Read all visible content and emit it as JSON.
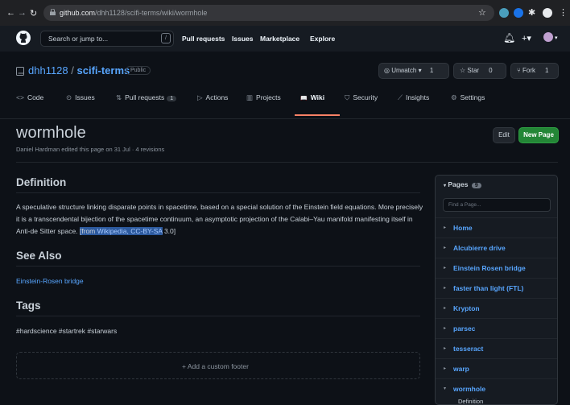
{
  "browser": {
    "url_host": "github.com",
    "url_path": "/dhh1128/scifi-terms/wiki/wormhole"
  },
  "header": {
    "search_placeholder": "Search or jump to...",
    "slash_key": "/",
    "nav": [
      "Pull requests",
      "Issues",
      "Marketplace",
      "Explore"
    ]
  },
  "repo": {
    "owner": "dhh1128",
    "separator": " / ",
    "name": "scifi-terms",
    "visibility": "Public",
    "unwatch_label": "Unwatch",
    "unwatch_count": "1",
    "star_label": "Star",
    "star_count": "0",
    "fork_label": "Fork",
    "fork_count": "1",
    "tabs": [
      {
        "label": "Code",
        "icon": "<>"
      },
      {
        "label": "Issues",
        "icon": "⊙"
      },
      {
        "label": "Pull requests",
        "icon": "⇅",
        "count": "1"
      },
      {
        "label": "Actions",
        "icon": "▷"
      },
      {
        "label": "Projects",
        "icon": "▥"
      },
      {
        "label": "Wiki",
        "icon": "📖"
      },
      {
        "label": "Security",
        "icon": "⛉"
      },
      {
        "label": "Insights",
        "icon": "⟋"
      },
      {
        "label": "Settings",
        "icon": "⚙"
      }
    ]
  },
  "page": {
    "title": "wormhole",
    "meta": "Daniel Hardman edited this page on 31 Jul · 4 revisions",
    "edit_label": "Edit",
    "new_page_label": "New Page",
    "definition_heading": "Definition",
    "definition_text": "A speculative structure linking disparate points in spacetime, based on a special solution of the Einstein field equations. More precisely it is a transcendental bijection of the spacetime continuum, an asymptotic projection of the Calabi–Yau manifold manifesting itself in Anti-de Sitter space. ",
    "attribution_prefix": "[from ",
    "attribution_link": "Wikipedia, CC-BY-SA",
    "attribution_suffix": " 3.0]",
    "see_also_heading": "See Also",
    "see_also_link": "Einstein-Rosen bridge",
    "tags_heading": "Tags",
    "tags_text": "#hardscience #startrek #starwars",
    "add_footer_label": "+ Add a custom footer"
  },
  "sidebar": {
    "pages_label": "Pages",
    "pages_count": "9",
    "find_placeholder": "Find a Page...",
    "items": [
      "Home",
      "Alcubierre drive",
      "Einstein Rosen bridge",
      "faster than light (FTL)",
      "Krypton",
      "parsec",
      "tesseract",
      "warp",
      "wormhole"
    ],
    "sub_item": "Definition"
  },
  "colors": {
    "accent": "#58a6ff",
    "new_page_bg": "#238636",
    "wiki_tab_underline": "#f78166"
  }
}
